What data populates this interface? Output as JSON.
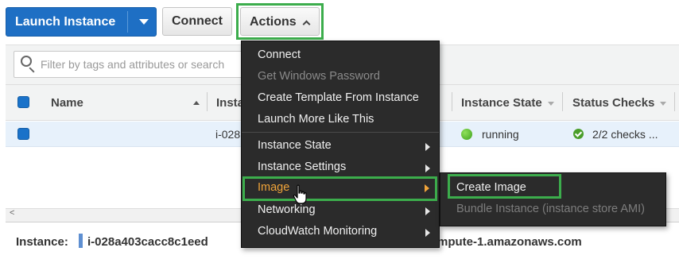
{
  "toolbar": {
    "launch_label": "Launch Instance",
    "connect_label": "Connect",
    "actions_label": "Actions"
  },
  "filter": {
    "placeholder": "Filter by tags and attributes or search"
  },
  "table": {
    "columns": {
      "name": "Name",
      "instance_id": "Insta",
      "instance_state": "Instance State",
      "status_checks": "Status Checks"
    },
    "rows": [
      {
        "instance_id": "i-028",
        "state": "running",
        "checks": "2/2 checks ..."
      }
    ]
  },
  "scroll_left": "<",
  "details": {
    "label": "Instance:",
    "id": "i-028a403cacc8c1eed",
    "dns": "mpute-1.amazonaws.com"
  },
  "actions_menu": {
    "items": [
      {
        "label": "Connect",
        "disabled": false
      },
      {
        "label": "Get Windows Password",
        "disabled": true
      },
      {
        "label": "Create Template From Instance",
        "disabled": false
      },
      {
        "label": "Launch More Like This",
        "disabled": false
      },
      {
        "label": "Instance State",
        "submenu": true
      },
      {
        "label": "Instance Settings",
        "submenu": true
      },
      {
        "label": "Image",
        "submenu": true,
        "active": true
      },
      {
        "label": "Networking",
        "submenu": true
      },
      {
        "label": "CloudWatch Monitoring",
        "submenu": true
      }
    ]
  },
  "image_submenu": {
    "items": [
      {
        "label": "Create Image",
        "disabled": false
      },
      {
        "label": "Bundle Instance (instance store AMI)",
        "disabled": true
      }
    ]
  },
  "colors": {
    "primary": "#1e6fc4",
    "highlight_outline": "#3cad4c",
    "menu_bg": "#2b2b2b",
    "active_item": "#f0a43a",
    "selected_row": "#e7f1fb"
  },
  "icons": [
    "caret-down-icon",
    "chevron-up-icon",
    "search-icon",
    "sort-asc-icon",
    "sort-desc-icon",
    "status-running-icon",
    "check-icon",
    "submenu-arrow-icon",
    "hand-cursor-icon"
  ]
}
